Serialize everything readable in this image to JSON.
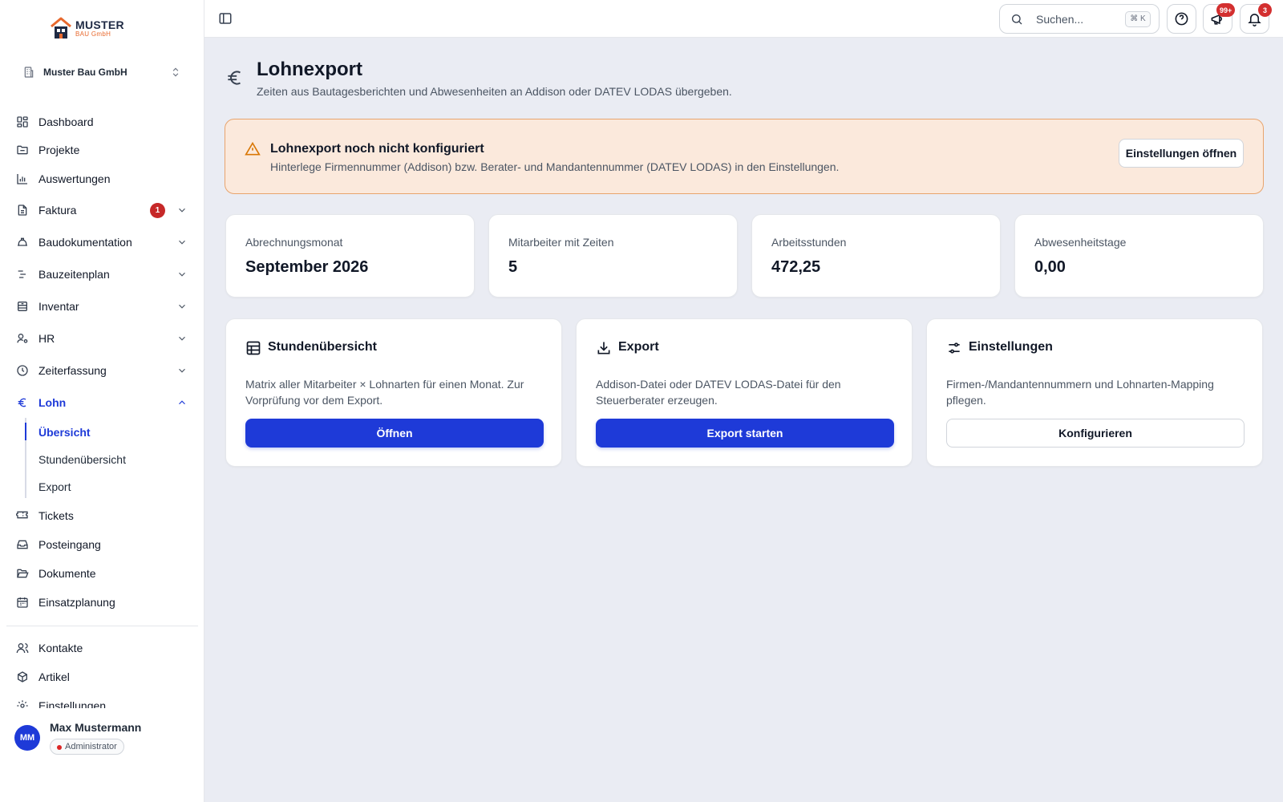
{
  "colors": {
    "accent": "#1e3ad8",
    "danger": "#c62828",
    "warning_bg": "#fbe9dc",
    "warning_border": "#e8a46d",
    "background": "#eaecf3"
  },
  "logo": {
    "line1": "MUSTER",
    "line2": "BAU GmbH"
  },
  "company": {
    "name": "Muster Bau GmbH"
  },
  "nav": [
    {
      "label": "Dashboard",
      "icon": "dashboard-icon"
    },
    {
      "label": "Projekte",
      "icon": "folder-icon"
    },
    {
      "label": "Auswertungen",
      "icon": "bar-chart-icon"
    },
    {
      "label": "Faktura",
      "icon": "invoice-icon",
      "badge": "1",
      "expandable": true
    },
    {
      "label": "Baudokumentation",
      "icon": "helmet-icon",
      "expandable": true
    },
    {
      "label": "Bauzeitenplan",
      "icon": "timeline-icon",
      "expandable": true
    },
    {
      "label": "Inventar",
      "icon": "inventory-icon",
      "expandable": true
    },
    {
      "label": "HR",
      "icon": "users-cog-icon",
      "expandable": true
    },
    {
      "label": "Zeiterfassung",
      "icon": "clock-icon",
      "expandable": true
    },
    {
      "label": "Lohn",
      "icon": "euro-icon",
      "expanded": true,
      "active": true
    },
    {
      "label": "Tickets",
      "icon": "ticket-icon"
    },
    {
      "label": "Posteingang",
      "icon": "inbox-icon"
    },
    {
      "label": "Dokumente",
      "icon": "folder-open-icon"
    },
    {
      "label": "Einsatzplanung",
      "icon": "calendar-icon"
    },
    {
      "label": "Kontakte",
      "icon": "contacts-icon"
    },
    {
      "label": "Artikel",
      "icon": "package-icon"
    },
    {
      "label": "Einstellungen",
      "icon": "settings-icon"
    }
  ],
  "subnav": [
    {
      "label": "Übersicht",
      "active": true
    },
    {
      "label": "Stundenübersicht"
    },
    {
      "label": "Export"
    }
  ],
  "user": {
    "initials": "MM",
    "name": "Max Mustermann",
    "role": "Administrator"
  },
  "topbar": {
    "search_placeholder": "Suchen...",
    "shortcut": "⌘ K",
    "announcements_badge": "99+",
    "notifications_badge": "3"
  },
  "page": {
    "title": "Lohnexport",
    "subtitle": "Zeiten aus Bautagesberichten und Abwesenheiten an Addison oder DATEV LODAS übergeben."
  },
  "alert": {
    "title": "Lohnexport noch nicht konfiguriert",
    "text": "Hinterlege Firmennummer (Addison) bzw. Berater- und Mandantennummer (DATEV LODAS) in den Einstellungen.",
    "button": "Einstellungen öffnen"
  },
  "stats": [
    {
      "label": "Abrechnungsmonat",
      "value": "September 2026"
    },
    {
      "label": "Mitarbeiter mit Zeiten",
      "value": "5"
    },
    {
      "label": "Arbeitsstunden",
      "value": "472,25"
    },
    {
      "label": "Abwesenheitstage",
      "value": "0,00"
    }
  ],
  "cards": [
    {
      "title": "Stundenübersicht",
      "icon": "table-icon",
      "desc": "Matrix aller Mitarbeiter × Lohnarten für einen Monat. Zur Vorprüfung vor dem Export.",
      "button": "Öffnen"
    },
    {
      "title": "Export",
      "icon": "download-icon",
      "desc": "Addison-Datei oder DATEV LODAS-Datei für den Steuerberater erzeugen.",
      "button": "Export starten"
    },
    {
      "title": "Einstellungen",
      "icon": "sliders-icon",
      "desc": "Firmen-/Mandantennummern und Lohnarten-Mapping pflegen.",
      "button": "Konfigurieren"
    }
  ]
}
